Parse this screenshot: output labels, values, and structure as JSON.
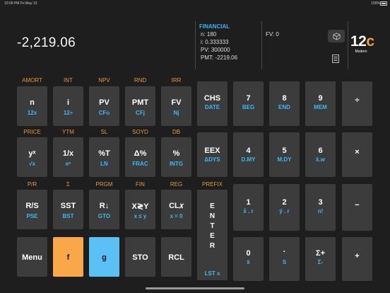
{
  "status": {
    "time": "10:09 PM   Fri May 13",
    "battery": "100%"
  },
  "display": {
    "value": "-2,219.06",
    "mode": "FINANCIAL",
    "registers": [
      "n: 180",
      "i: 0.333333",
      "PV: 300000",
      "PMT: -2219.06"
    ],
    "fv": "FV: 0"
  },
  "icons": {
    "shortcut": "cube-icon",
    "tape": "document-icon"
  },
  "logo": {
    "number": "12",
    "letter": "c",
    "sub": "Modern"
  },
  "keys": {
    "n": {
      "top": "AMORT",
      "main": "n",
      "sub": "12x"
    },
    "i": {
      "top": "INT",
      "main": "i",
      "sub": "12÷"
    },
    "pv": {
      "top": "NPV",
      "main": "PV",
      "sub": "CFo"
    },
    "pmt": {
      "top": "RND",
      "main": "PMT",
      "sub": "CFj"
    },
    "fv": {
      "top": "IRR",
      "main": "FV",
      "sub": "Nj"
    },
    "chs": {
      "main": "CHS",
      "sub": "DATE"
    },
    "k7": {
      "main": "7",
      "sub": "BEG"
    },
    "k8": {
      "main": "8",
      "sub": "END"
    },
    "k9": {
      "main": "9",
      "sub": "MEM"
    },
    "div": {
      "main": "÷"
    },
    "yx": {
      "top": "PRICE",
      "main": "yˣ",
      "sub": "√x"
    },
    "inv": {
      "top": "YTM",
      "main": "1/x",
      "sub": "eˣ"
    },
    "pct_t": {
      "top": "SL",
      "main": "%T",
      "sub": "LN"
    },
    "dpct": {
      "top": "SOYD",
      "main": "Δ%",
      "sub": "FRAC"
    },
    "pct": {
      "top": "DB",
      "main": "%",
      "sub": "INTG"
    },
    "eex": {
      "main": "EEX",
      "sub": "ΔDYS"
    },
    "k4": {
      "main": "4",
      "sub": "D.MY"
    },
    "k5": {
      "main": "5",
      "sub": "M.DY"
    },
    "k6": {
      "main": "6",
      "sub": "x̄.w"
    },
    "mul": {
      "main": "×"
    },
    "rs": {
      "top": "P/R",
      "main": "R/S",
      "sub": "PSE"
    },
    "sst": {
      "top": "Σ",
      "main": "SST",
      "sub": "BST"
    },
    "rdown": {
      "top": "PRGM",
      "main": "R↓",
      "sub": "GTO"
    },
    "xy": {
      "top": "FIN",
      "main": "X≷Y",
      "sub": "x ≤ y"
    },
    "clx": {
      "top": "REG",
      "main": "CL𝑥",
      "sub": "x = 0"
    },
    "enter": {
      "top": "PREFIX",
      "letters": [
        "E",
        "N",
        "T",
        "E",
        "R"
      ],
      "sub": "LST x"
    },
    "k1": {
      "main": "1",
      "sub": "x̂ . r"
    },
    "k2": {
      "main": "2",
      "sub": "ŷ . r"
    },
    "k3": {
      "main": "3",
      "sub": "n!"
    },
    "sub": {
      "main": "−"
    },
    "menu": {
      "main": "Menu"
    },
    "f": {
      "main": "f"
    },
    "g": {
      "main": "g"
    },
    "sto": {
      "main": "STO"
    },
    "rcl": {
      "main": "RCL"
    },
    "k0": {
      "main": "0",
      "sub": "x̄"
    },
    "dot": {
      "main": "·",
      "sub": "S"
    },
    "sigma": {
      "main": "Σ+",
      "sub": "Σ-"
    },
    "add": {
      "main": "+"
    }
  }
}
